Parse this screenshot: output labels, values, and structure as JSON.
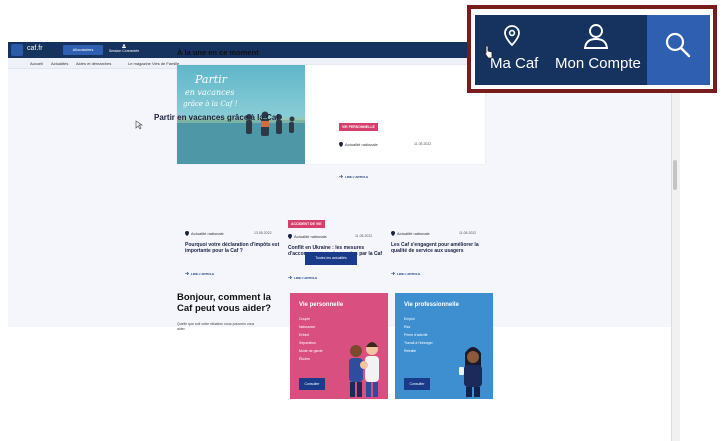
{
  "header": {
    "logo_text": "caf.fr",
    "audience_label": "Allocataires",
    "session_label": "Session Connectée",
    "utility": {
      "ma_caf": "Ma Caf",
      "mon_compte": "Mon Compte"
    }
  },
  "subnav": [
    "Accueil",
    "Actualités",
    "Aides et démarches",
    "Le magazine Vies de Famille"
  ],
  "une": {
    "title": "À la une en ce moment",
    "featured": {
      "image_caption": "Partir en vacances grâce à la Caf !",
      "badge": "VIE PERSONNELLE",
      "tag": "Actualité nationale",
      "date": "11.05.2022",
      "title": "Partir en vacances grâce à la Caf",
      "read_more": "LIRE L'ARTICLE"
    },
    "articles": [
      {
        "badge": "",
        "tag": "Actualité nationale",
        "date": "13.05.2022",
        "title": "Pourquoi votre déclaration d'impôts est importante pour la Caf ?",
        "read_more": "LIRE L'ARTICLE"
      },
      {
        "badge": "ACCIDENT DE VIE",
        "tag": "Actualité nationale",
        "date": "11.05.2022",
        "title": "Conflit en Ukraine : les mesures d'accompagnement assurées par la Caf",
        "read_more": "LIRE L'ARTICLE"
      },
      {
        "badge": "",
        "tag": "Actualité nationale",
        "date": "11.05.2022",
        "title": "Les Caf s'engagent pour améliorer la qualité de service aux usagers",
        "read_more": "LIRE L'ARTICLE"
      }
    ],
    "all_news_button": "Toutes les actualités"
  },
  "help": {
    "title": "Bonjour, comment la Caf peut vous aider?",
    "subtitle": "Quelle que soit votre situation nous pouvons vous aider",
    "cards": [
      {
        "title": "Vie personnelle",
        "items": [
          "Couple",
          "Naissance",
          "Enfant",
          "Séparation",
          "Mode de garde",
          "Études"
        ],
        "button": "Consulter",
        "color": "#d94f80"
      },
      {
        "title": "Vie professionnelle",
        "items": [
          "Emploi",
          "Rsa",
          "Prime d'activité",
          "Travail à l'étranger",
          "Retraite"
        ],
        "button": "Consulter",
        "color": "#3d8fd0"
      }
    ]
  },
  "colors": {
    "navy": "#16335f",
    "accent_blue": "#2f5fb0",
    "badge_pink": "#d63e6b",
    "zoom_frame": "#7a1c1c"
  },
  "icons": [
    "location-pin-icon",
    "user-icon",
    "search-icon",
    "arrow-right-icon",
    "cursor-icon"
  ]
}
